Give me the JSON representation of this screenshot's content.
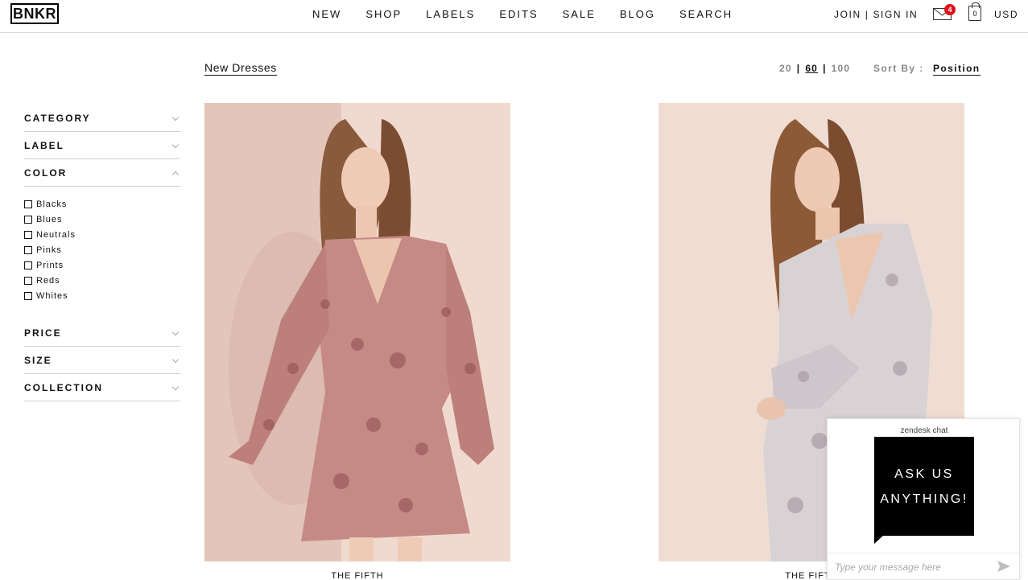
{
  "header": {
    "logo": "BNKR",
    "nav": [
      "NEW",
      "SHOP",
      "LABELS",
      "EDITS",
      "SALE",
      "BLOG",
      "SEARCH"
    ],
    "join": "JOIN",
    "sign_in": "SIGN IN",
    "separator": "|",
    "messages_count": "4",
    "bag_count": "0",
    "currency": "USD"
  },
  "toolbar": {
    "page_title": "New Dresses",
    "per_page": [
      "20",
      "60",
      "100"
    ],
    "per_page_active": "60",
    "per_page_sep": "|",
    "sort_label": "Sort By :",
    "sort_value": "Position"
  },
  "filters": {
    "category": "CATEGORY",
    "label": "LABEL",
    "color": "COLOR",
    "colors": [
      "Blacks",
      "Blues",
      "Neutrals",
      "Pinks",
      "Prints",
      "Reds",
      "Whites"
    ],
    "price": "PRICE",
    "size": "SIZE",
    "collection": "COLLECTION"
  },
  "products": [
    {
      "brand": "THE FIFTH",
      "dress_color": "#c58a85"
    },
    {
      "brand": "THE FIFTH",
      "dress_color": "#cfc8cc"
    }
  ],
  "chat": {
    "brand": "zendesk chat",
    "line1": "ASK US",
    "line2": "ANYTHING!",
    "placeholder": "Type your message here"
  }
}
